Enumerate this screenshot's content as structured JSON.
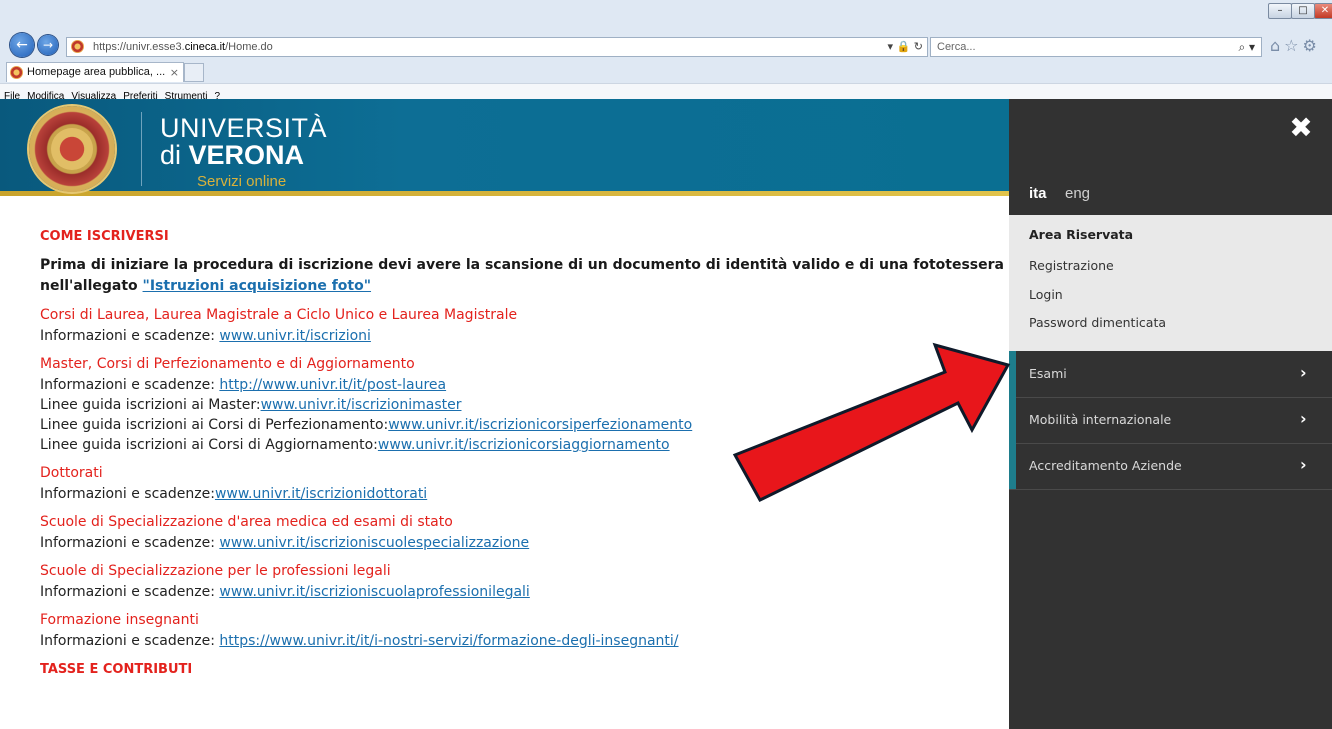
{
  "browser": {
    "url_prefix": "https://univr.esse3.",
    "url_domain": "cineca.it",
    "url_path": "/Home.do",
    "search_placeholder": "Cerca...",
    "tab_title": "Homepage area pubblica, ...",
    "tab_close": "×",
    "menu": [
      "File",
      "Modifica",
      "Visualizza",
      "Preferiti",
      "Strumenti",
      "?"
    ]
  },
  "header": {
    "line1": "UNIVERSITÀ",
    "line2_di": "di",
    "line2_name": "VERONA",
    "subtitle": "Servizi online"
  },
  "main": {
    "heading_iscriversi": "COME ISCRIVERSI",
    "intro_line1": "Prima di iniziare la procedura di iscrizione devi avere la scansione di un documento di identità valido e di una fototessera con",
    "intro_line2_prefix": "nell'allegato ",
    "intro_link": "\"Istruzioni acquisizione foto\"",
    "blocks": [
      {
        "title": "Corsi di Laurea, Laurea Magistrale a Ciclo Unico e Laurea Magistrale",
        "lines": [
          {
            "text": "Informazioni e scadenze: ",
            "link": "www.univr.it/iscrizioni"
          }
        ]
      },
      {
        "title": "Master, Corsi di Perfezionamento e di Aggiornamento",
        "lines": [
          {
            "text": "Informazioni e scadenze: ",
            "link": "http://www.univr.it/it/post-laurea"
          },
          {
            "text": "Linee guida iscrizioni ai Master:",
            "link": "www.univr.it/iscrizionimaster"
          },
          {
            "text": "Linee guida iscrizioni ai Corsi di Perfezionamento:",
            "link": "www.univr.it/iscrizionicorsiperfezionamento"
          },
          {
            "text": "Linee guida iscrizioni ai Corsi di Aggiornamento:",
            "link": "www.univr.it/iscrizionicorsiaggiornamento"
          }
        ]
      },
      {
        "title": "Dottorati",
        "lines": [
          {
            "text": "Informazioni e scadenze:",
            "link": "www.univr.it/iscrizionidottorati"
          }
        ]
      },
      {
        "title": "Scuole di Specializzazione d'area medica ed esami di stato",
        "lines": [
          {
            "text": "Informazioni e scadenze: ",
            "link": "www.univr.it/iscrizioniscuolespecializzazione"
          }
        ]
      },
      {
        "title": "Scuole di Specializzazione per le professioni legali",
        "lines": [
          {
            "text": "Informazioni e scadenze: ",
            "link": "www.univr.it/iscrizioniscuolaprofessionilegali"
          }
        ]
      },
      {
        "title": "Formazione insegnanti",
        "lines": [
          {
            "text": "Informazioni e scadenze: ",
            "link": "https://www.univr.it/it/i-nostri-servizi/formazione-degli-insegnanti/"
          }
        ]
      }
    ],
    "heading_tasse": "TASSE E CONTRIBUTI"
  },
  "panel": {
    "lang_ita": "ita",
    "lang_eng": "eng",
    "reserved_title": "Area Riservata",
    "reserved_links": [
      "Registrazione",
      "Login",
      "Password dimenticata"
    ],
    "menu": [
      "Esami",
      "Mobilità internazionale",
      "Accreditamento Aziende"
    ],
    "accent_color": "#1e7d8c"
  },
  "annotation": {
    "arrow_color": "#e8161b"
  }
}
